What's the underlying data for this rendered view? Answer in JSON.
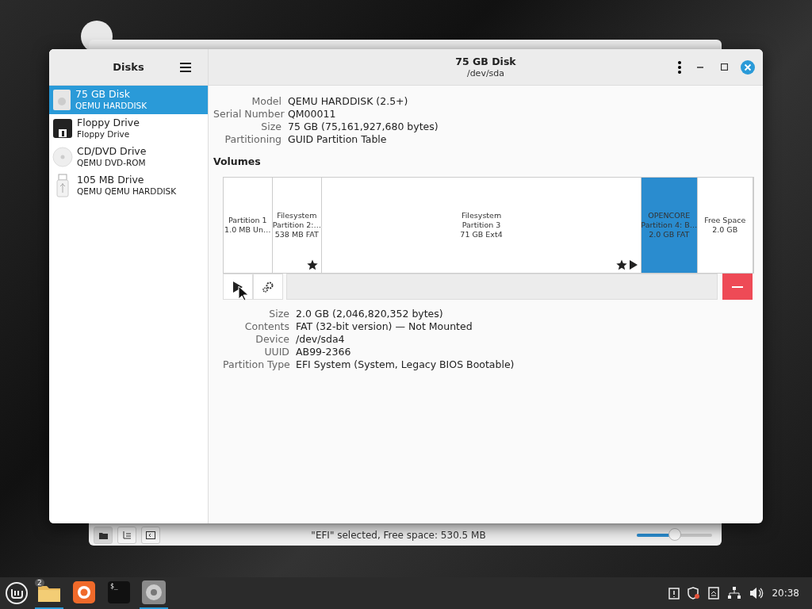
{
  "sidebar": {
    "title": "Disks",
    "items": [
      {
        "name": "75 GB Disk",
        "detail": "QEMU HARDDISK",
        "kind": "hdd",
        "selected": true
      },
      {
        "name": "Floppy Drive",
        "detail": "Floppy Drive",
        "kind": "floppy",
        "selected": false
      },
      {
        "name": "CD/DVD Drive",
        "detail": "QEMU DVD-ROM",
        "kind": "optical",
        "selected": false
      },
      {
        "name": "105 MB Drive",
        "detail": "QEMU QEMU HARDDISK",
        "kind": "usb",
        "selected": false
      }
    ]
  },
  "header": {
    "title": "75 GB Disk",
    "subtitle": "/dev/sda"
  },
  "disk_info": [
    {
      "label": "Model",
      "value": "QEMU HARDDISK (2.5+)"
    },
    {
      "label": "Serial Number",
      "value": "QM00011"
    },
    {
      "label": "Size",
      "value": "75 GB (75,161,927,680 bytes)"
    },
    {
      "label": "Partitioning",
      "value": "GUID Partition Table"
    }
  ],
  "volumes": {
    "title": "Volumes",
    "partitions": [
      {
        "lines": [
          "Partition 1",
          "1.0 MB Un…"
        ],
        "star": false,
        "arrow": false,
        "selected": false
      },
      {
        "lines": [
          "Filesystem",
          "Partition 2:…",
          "538 MB FAT"
        ],
        "star": true,
        "arrow": false,
        "selected": false
      },
      {
        "lines": [
          "Filesystem",
          "Partition 3",
          "71 GB Ext4"
        ],
        "star": true,
        "arrow": true,
        "selected": false
      },
      {
        "lines": [
          "OPENCORE",
          "Partition 4: B…",
          "2.0 GB FAT"
        ],
        "star": false,
        "arrow": false,
        "selected": true
      },
      {
        "lines": [
          "Free Space",
          "2.0 GB"
        ],
        "star": false,
        "arrow": false,
        "selected": false
      }
    ]
  },
  "volume_info": [
    {
      "label": "Size",
      "value": "2.0 GB (2,046,820,352 bytes)"
    },
    {
      "label": "Contents",
      "value": "FAT (32-bit version) — Not Mounted"
    },
    {
      "label": "Device",
      "value": "/dev/sda4"
    },
    {
      "label": "UUID",
      "value": "AB99-2366"
    },
    {
      "label": "Partition Type",
      "value": "EFI System (System, Legacy BIOS Bootable)"
    }
  ],
  "back_window": {
    "status": "\"EFI\" selected, Free space: 530.5 MB",
    "zoom": {
      "level": 0.5
    }
  },
  "taskbar": {
    "apps": [
      {
        "kind": "files",
        "badge": "2",
        "active": true
      },
      {
        "kind": "browser",
        "active": false
      },
      {
        "kind": "terminal",
        "label": "$_",
        "active": false
      },
      {
        "kind": "disks",
        "active": true
      }
    ],
    "clock": "20:38"
  }
}
